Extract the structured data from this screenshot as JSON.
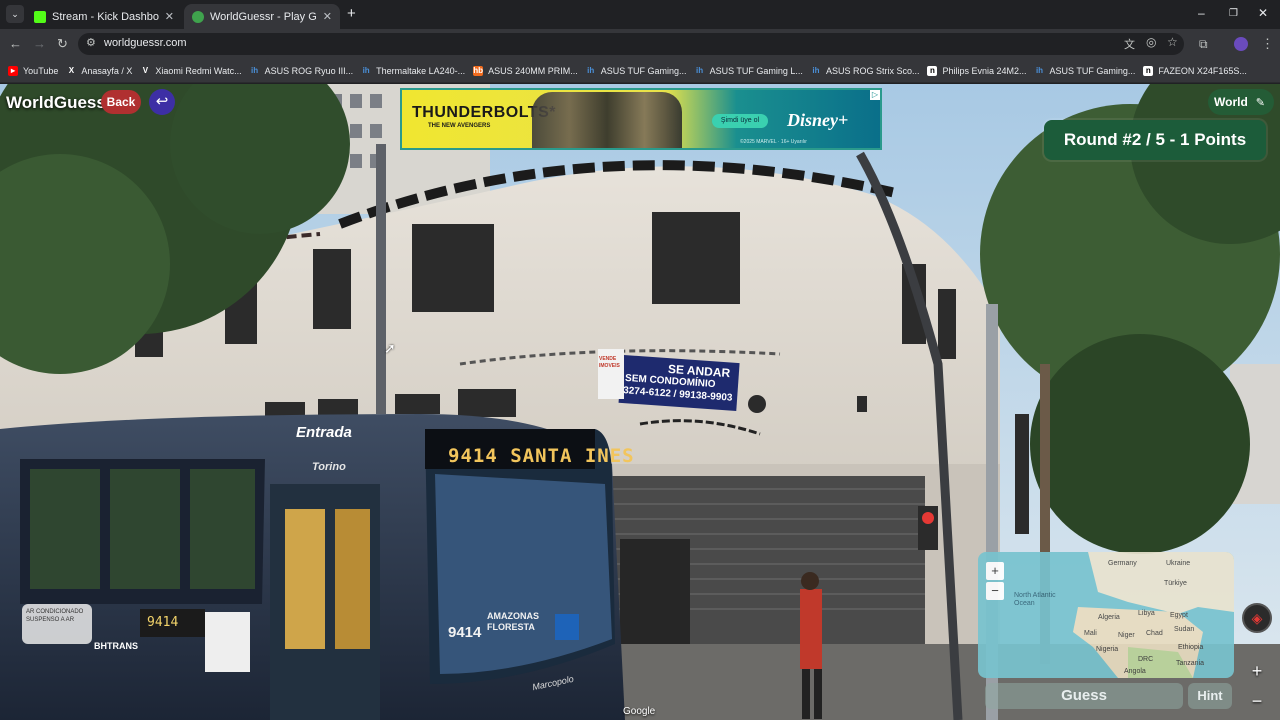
{
  "browser": {
    "tabs": [
      {
        "title": "Stream - Kick Dashboard",
        "active": false,
        "favicon_color": "#53fc18"
      },
      {
        "title": "WorldGuessr - Play Geoguessr Free",
        "active": true,
        "favicon_color": "#3fa34d"
      }
    ],
    "new_tab": "+",
    "url": "worldguessr.com",
    "bookmarks": [
      {
        "label": "YouTube",
        "icon": "youtube-icon",
        "color": "#ff0000"
      },
      {
        "label": "Anasayfa / X",
        "icon": "x-icon",
        "color": "#ffffff"
      },
      {
        "label": "Xiaomi Redmi Watc...",
        "icon": "v-icon",
        "color": "#ffffff"
      },
      {
        "label": "ASUS ROG Ryuo III...",
        "icon": "hepsiburada-icon",
        "color": "#4a90d9"
      },
      {
        "label": "Thermaltake LA240-...",
        "icon": "hepsiburada-icon",
        "color": "#4a90d9"
      },
      {
        "label": "ASUS 240MM PRIM...",
        "icon": "hb-icon",
        "color": "#f26b1d"
      },
      {
        "label": "ASUS TUF Gaming...",
        "icon": "hepsiburada-icon",
        "color": "#4a90d9"
      },
      {
        "label": "ASUS TUF Gaming L...",
        "icon": "hepsiburada-icon",
        "color": "#4a90d9"
      },
      {
        "label": "ASUS ROG Strix Sco...",
        "icon": "hepsiburada-icon",
        "color": "#4a90d9"
      },
      {
        "label": "Philips Evnia 24M2...",
        "icon": "n11-icon",
        "color": "#ffffff"
      },
      {
        "label": "ASUS TUF Gaming...",
        "icon": "hepsiburada-icon",
        "color": "#4a90d9"
      },
      {
        "label": "FAZEON X24F165S...",
        "icon": "n11-icon",
        "color": "#ffffff"
      }
    ]
  },
  "game": {
    "logo": "WorldGuessr",
    "back_label": "Back",
    "map_mode": "World",
    "round_banner": "Round #2 / 5 - 1 Points",
    "guess_label": "Guess",
    "hint_label": "Hint",
    "google_watermark": "Google",
    "map_zoom_in": "+",
    "map_zoom_out": "−",
    "sv_zoom_in": "+",
    "sv_zoom_out": "−"
  },
  "ad": {
    "title": "THUNDERBOLTS*",
    "subtitle": "THE NEW AVENGERS",
    "cta": "Şimdi üye ol",
    "brand": "Disney+",
    "fine_print": "©2025 MARVEL · 16+ Uyarılır"
  },
  "scene": {
    "bus_route": "9414 SANTA INES",
    "bus_side_text": "Entrada",
    "bus_model": "Torino",
    "bus_front_number": "9414",
    "bus_front_dest": "AMAZONAS FLORESTA",
    "bus_side_number": "9414",
    "bus_brand": "Marcopolo",
    "bus_operator": "BHTRANS",
    "bus_ac_sign": "AR CONDICIONADO SUSPENSO A AR",
    "sign_line1": "SE ANDAR",
    "sign_line2": "SEM CONDOMÍNIO",
    "sign_line3": "3274-6122 / 99138-9903",
    "sign_side": "VENDE IMOVEIS"
  },
  "minimap_labels": [
    "Germany",
    "Ukraine",
    "North Atlantic Ocean",
    "Türkiye",
    "Algeria",
    "Libya",
    "Egypt",
    "Mali",
    "Niger",
    "Chad",
    "Sudan",
    "Nigeria",
    "Ethiopia",
    "DRC",
    "Tanzania",
    "Angola"
  ],
  "colors": {
    "round_banner": "#1c5c3a",
    "back_button": "#b03030",
    "guess_button": "#8fa8a0"
  }
}
